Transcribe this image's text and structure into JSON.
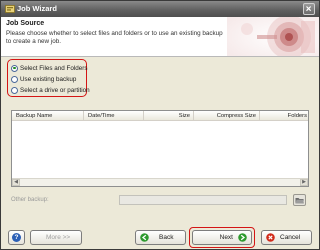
{
  "window": {
    "title": "Job Wizard"
  },
  "header": {
    "title": "Job Source",
    "description": "Please choose whether to select files and folders or to use an existing backup to create a new job."
  },
  "source_options": [
    {
      "label": "Select Files and Folders",
      "checked": true
    },
    {
      "label": "Use existing backup",
      "checked": false
    },
    {
      "label": "Select a drive or partition",
      "checked": false
    }
  ],
  "backup_list": {
    "columns": [
      "Backup Name",
      "Date/Time",
      "Size",
      "Compress Size",
      "Folders"
    ],
    "rows": []
  },
  "other_backup": {
    "label": "Other backup:",
    "value": ""
  },
  "buttons": {
    "help": "?",
    "more": "More >>",
    "back": "Back",
    "next": "Next",
    "cancel": "Cancel"
  },
  "colors": {
    "highlight": "#d41515",
    "checked_radio": "#1f8a22",
    "back_icon": "#2e9a2e",
    "next_icon": "#2e9a2e",
    "cancel_icon": "#d12a1a",
    "help_icon": "#2b5fb5"
  },
  "icons": {
    "app": "wizard-app-icon",
    "close": "close-icon",
    "browse": "folder-browse-icon",
    "help": "help-icon",
    "back": "back-arrow-icon",
    "next": "next-arrow-icon",
    "cancel": "cancel-icon"
  }
}
